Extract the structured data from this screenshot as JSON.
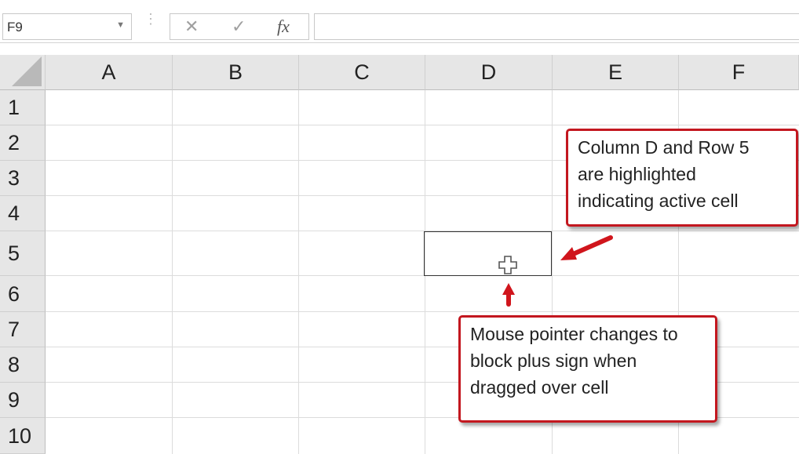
{
  "formula_bar": {
    "name_box_value": "F9",
    "cancel_glyph": "✕",
    "enter_glyph": "✓",
    "fx_label": "fx",
    "formula_value": ""
  },
  "columns": [
    "A",
    "B",
    "C",
    "D",
    "E",
    "F"
  ],
  "rows": [
    "1",
    "2",
    "3",
    "4",
    "5",
    "6",
    "7",
    "8",
    "9",
    "10"
  ],
  "active_cell": {
    "column": "D",
    "row": "5"
  },
  "annotations": {
    "callout_active_cell": [
      "Column D and Row 5",
      "are highlighted",
      "indicating active cell"
    ],
    "callout_pointer": [
      "Mouse pointer changes to",
      "block plus sign when",
      "dragged over cell"
    ]
  },
  "colors": {
    "callout_border": "#c3171f",
    "arrow": "#d0151c",
    "header_bg": "#e6e6e6",
    "gridline": "#dcdcdc"
  }
}
